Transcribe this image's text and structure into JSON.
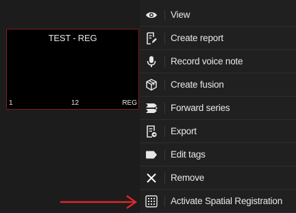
{
  "thumbnail": {
    "title": "TEST - REG",
    "index": "1",
    "count": "12",
    "modality": "REG"
  },
  "menu": {
    "items": [
      {
        "label": "View",
        "icon": "eye-icon"
      },
      {
        "label": "Create report",
        "icon": "report-edit-icon"
      },
      {
        "label": "Record voice note",
        "icon": "microphone-icon"
      },
      {
        "label": "Create fusion",
        "icon": "cube-fusion-icon"
      },
      {
        "label": "Forward series",
        "icon": "stack-forward-icon"
      },
      {
        "label": "Export",
        "icon": "export-document-icon"
      },
      {
        "label": "Edit tags",
        "icon": "tag-icon"
      },
      {
        "label": "Remove",
        "icon": "close-icon"
      },
      {
        "label": "Activate Spatial Registration",
        "icon": "grid-registration-icon"
      }
    ]
  },
  "annotation": {
    "arrow_color": "#e0262b"
  }
}
